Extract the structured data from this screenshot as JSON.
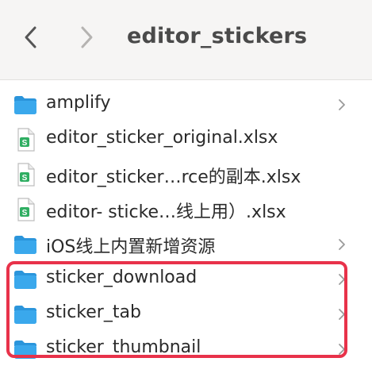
{
  "window": {
    "title": "editor_stickers"
  },
  "colors": {
    "folder": "#3aa8ec",
    "folder_dark": "#2b95db",
    "sheet_green": "#2fae62",
    "highlight": "#e8324a"
  },
  "files": [
    {
      "label": "amplify",
      "type": "folder",
      "icon": "folder-icon",
      "has_chevron": true
    },
    {
      "label": "editor_sticker_original.xlsx",
      "type": "spreadsheet",
      "icon": "spreadsheet-icon",
      "has_chevron": false
    },
    {
      "label": "editor_sticker…rce的副本.xlsx",
      "type": "spreadsheet",
      "icon": "spreadsheet-icon",
      "has_chevron": false
    },
    {
      "label": "editor- sticke…线上用）.xlsx",
      "type": "spreadsheet",
      "icon": "spreadsheet-icon",
      "has_chevron": false
    },
    {
      "label": "iOS线上内置新增资源",
      "type": "folder",
      "icon": "folder-icon",
      "has_chevron": true
    },
    {
      "label": "sticker_download",
      "type": "folder",
      "icon": "folder-icon",
      "has_chevron": true
    },
    {
      "label": "sticker_tab",
      "type": "folder",
      "icon": "folder-icon",
      "has_chevron": true
    },
    {
      "label": "sticker_thumbnail",
      "type": "folder",
      "icon": "folder-icon",
      "has_chevron": true
    }
  ]
}
